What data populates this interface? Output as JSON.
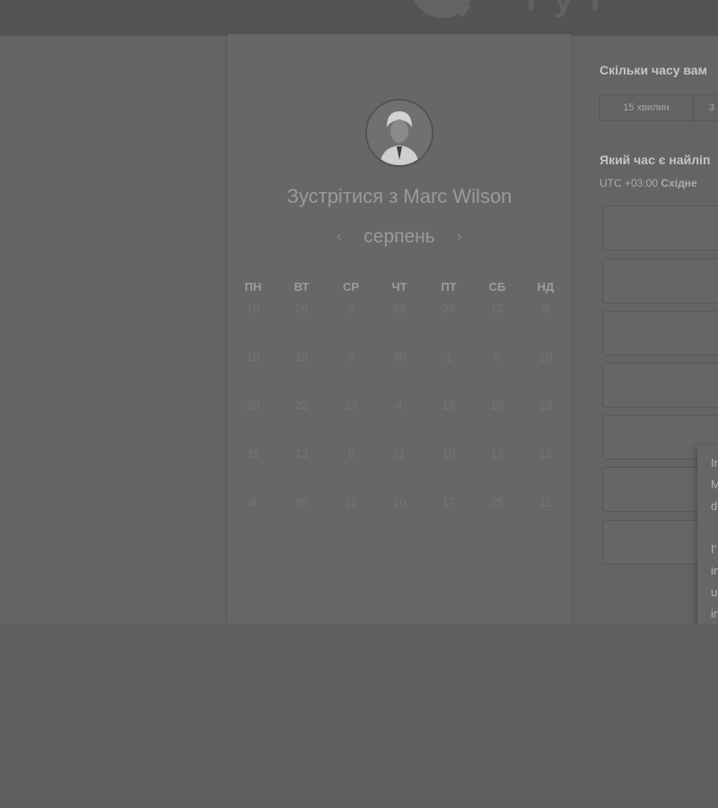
{
  "header": {
    "logo_text": "тут g"
  },
  "calendar": {
    "title": "Зустрітися з Marc Wilson",
    "month": "серпень",
    "prev_glyph": "‹",
    "next_glyph": "›",
    "weekdays": [
      "ПН",
      "ВТ",
      "СР",
      "ЧТ",
      "ПТ",
      "СБ",
      "НД"
    ],
    "weeks": [
      [
        "10",
        "26",
        "9",
        "29",
        "24",
        "12",
        "9"
      ],
      [
        "10",
        "19",
        "9",
        "30",
        "1",
        "6",
        "10"
      ],
      [
        "20",
        "22",
        "17",
        "4",
        "15",
        "10",
        "19"
      ],
      [
        "11",
        "13",
        "6",
        "11",
        "10",
        "12",
        "12"
      ],
      [
        "4",
        "20",
        "10",
        "10",
        "17",
        "25",
        "11"
      ]
    ]
  },
  "booking": {
    "duration_question": "Скільки часу вам",
    "durations": [
      "15 хвилин",
      "3"
    ],
    "time_question": "Який час є найліп",
    "timezone_prefix": "UTC +03:00",
    "timezone_name": "Східне",
    "slot_count": 7
  },
  "chat": {
    "lines": [
      "In",
      "M",
      "d",
      "",
      "I'",
      "in",
      "u",
      "in",
      "p"
    ]
  },
  "icons": {
    "avatar": "avatar-photo",
    "logo": "chat-bubble-logo"
  }
}
